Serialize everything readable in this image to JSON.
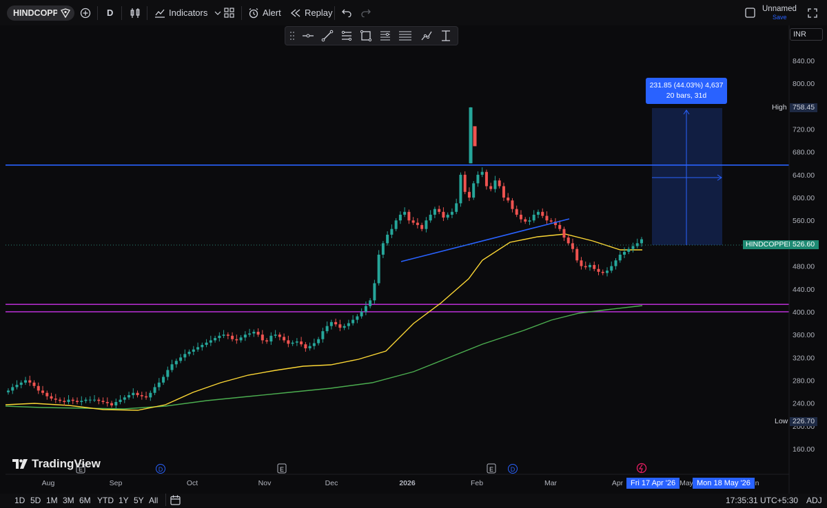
{
  "header": {
    "symbol": "HINDCOPPER",
    "interval": "D",
    "indicators_label": "Indicators",
    "alert_label": "Alert",
    "replay_label": "Replay",
    "layout_name": "Unnamed",
    "save_label": "Save"
  },
  "currency": "INR",
  "measure": {
    "line1": "231.85 (44.03%) 4,637",
    "line2": "20 bars, 31d"
  },
  "price_labels": {
    "high_label": "High",
    "high_value": "758.45",
    "low_label": "Low",
    "low_value": "226.70",
    "symbol_tag": "HINDCOPPER",
    "last_value": "526.60"
  },
  "date_tags": {
    "start": "Fri 17 Apr '26",
    "end": "Mon 18 May '26"
  },
  "footer": {
    "ranges": [
      "1D",
      "5D",
      "1M",
      "3M",
      "6M",
      "YTD",
      "1Y",
      "5Y",
      "All"
    ],
    "clock": "17:35:31 UTC+5:30",
    "adj": "ADJ"
  },
  "brand": "TradingView",
  "chart_data": {
    "type": "candlestick",
    "y_axis_ticks": [
      "840.00",
      "800.00",
      "760.00",
      "720.00",
      "680.00",
      "640.00",
      "600.00",
      "560.00",
      "520.00",
      "480.00",
      "440.00",
      "400.00",
      "360.00",
      "320.00",
      "280.00",
      "240.00",
      "200.00",
      "160.00"
    ],
    "x_axis_ticks": [
      "Aug",
      "Sep",
      "Oct",
      "Nov",
      "Dec",
      "2026",
      "Feb",
      "Mar",
      "Apr",
      "May",
      "Jun"
    ],
    "event_markers": [
      {
        "month": "Aug",
        "label": "E"
      },
      {
        "month": "Sep",
        "label": "D"
      },
      {
        "month": "Nov",
        "label": "E"
      },
      {
        "month": "Feb",
        "label": "E"
      },
      {
        "month": "Feb",
        "label": "D"
      }
    ],
    "horizontal_lines": [
      {
        "price": 657,
        "color": "#2962ff"
      },
      {
        "price": 413,
        "color": "#b02cc9"
      },
      {
        "price": 400,
        "color": "#b02cc9"
      }
    ],
    "closes": [
      262,
      268,
      272,
      276,
      280,
      276,
      270,
      262,
      258,
      252,
      248,
      246,
      244,
      242,
      246,
      244,
      242,
      244,
      246,
      246,
      246,
      244,
      242,
      240,
      236,
      242,
      246,
      250,
      254,
      258,
      254,
      252,
      250,
      258,
      268,
      276,
      286,
      298,
      308,
      314,
      320,
      326,
      330,
      334,
      338,
      342,
      346,
      350,
      354,
      358,
      360,
      358,
      352,
      350,
      355,
      360,
      362,
      365,
      360,
      350,
      348,
      358,
      360,
      356,
      350,
      344,
      346,
      348,
      343,
      336,
      340,
      345,
      352,
      366,
      375,
      382,
      378,
      372,
      375,
      380,
      386,
      392,
      400,
      410,
      420,
      450,
      500,
      520,
      535,
      545,
      560,
      570,
      575,
      560,
      556,
      552,
      545,
      560,
      570,
      580,
      575,
      565,
      570,
      575,
      590,
      640,
      610,
      600,
      625,
      640,
      645,
      620,
      615,
      630,
      620,
      600,
      595,
      580,
      570,
      562,
      558,
      560,
      570,
      575,
      568,
      560,
      558,
      552,
      545,
      530,
      520,
      510,
      490,
      480,
      478,
      482,
      475,
      470,
      468,
      472,
      480,
      490,
      500,
      505,
      510,
      515,
      520,
      527
    ],
    "high_label": "758.45",
    "low_label": "226.70",
    "last": "526.60"
  }
}
